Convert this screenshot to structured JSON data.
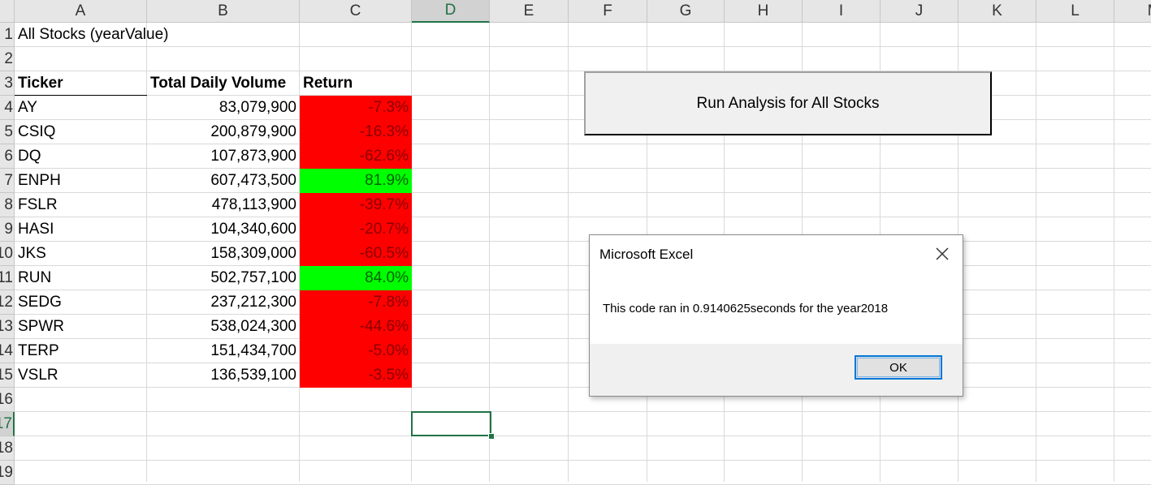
{
  "columns": [
    "A",
    "B",
    "C",
    "D",
    "E",
    "F",
    "G",
    "H",
    "I",
    "J",
    "K",
    "L",
    "M"
  ],
  "rows": [
    "1",
    "2",
    "3",
    "4",
    "5",
    "6",
    "7",
    "8",
    "9",
    "10",
    "11",
    "12",
    "13",
    "14",
    "15",
    "16",
    "17",
    "18",
    "19"
  ],
  "sheet": {
    "title": "All Stocks (yearValue)",
    "headers": {
      "ticker": "Ticker",
      "volume": "Total Daily Volume",
      "return": "Return"
    },
    "data": [
      {
        "ticker": "AY",
        "volume": "83,079,900",
        "return": "-7.3%",
        "positive": false
      },
      {
        "ticker": "CSIQ",
        "volume": "200,879,900",
        "return": "-16.3%",
        "positive": false
      },
      {
        "ticker": "DQ",
        "volume": "107,873,900",
        "return": "-62.6%",
        "positive": false
      },
      {
        "ticker": "ENPH",
        "volume": "607,473,500",
        "return": "81.9%",
        "positive": true
      },
      {
        "ticker": "FSLR",
        "volume": "478,113,900",
        "return": "-39.7%",
        "positive": false
      },
      {
        "ticker": "HASI",
        "volume": "104,340,600",
        "return": "-20.7%",
        "positive": false
      },
      {
        "ticker": "JKS",
        "volume": "158,309,000",
        "return": "-60.5%",
        "positive": false
      },
      {
        "ticker": "RUN",
        "volume": "502,757,100",
        "return": "84.0%",
        "positive": true
      },
      {
        "ticker": "SEDG",
        "volume": "237,212,300",
        "return": "-7.8%",
        "positive": false
      },
      {
        "ticker": "SPWR",
        "volume": "538,024,300",
        "return": "-44.6%",
        "positive": false
      },
      {
        "ticker": "TERP",
        "volume": "151,434,700",
        "return": "-5.0%",
        "positive": false
      },
      {
        "ticker": "VSLR",
        "volume": "136,539,100",
        "return": "-3.5%",
        "positive": false
      }
    ]
  },
  "run_button": {
    "label": "Run Analysis for All Stocks"
  },
  "dialog": {
    "title": "Microsoft Excel",
    "message": "This code ran in 0.9140625seconds for the year2018",
    "ok_label": "OK",
    "close_icon": "close-icon"
  },
  "selected": {
    "column": "D",
    "row": "17"
  },
  "colors": {
    "negative_fill": "#ff0000",
    "positive_fill": "#00ff00",
    "accent": "#217346",
    "dialog_focus": "#0078d7"
  }
}
